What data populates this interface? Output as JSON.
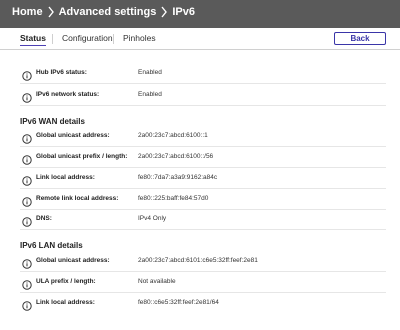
{
  "breadcrumb": {
    "items": [
      "Home",
      "Advanced settings",
      "IPv6"
    ]
  },
  "tabs": [
    {
      "label": "Status",
      "active": true
    },
    {
      "label": "Configuration",
      "active": false
    },
    {
      "label": "Pinholes",
      "active": false
    }
  ],
  "back_button": "Back",
  "status": {
    "hub_ipv6_label": "Hub IPv6 status:",
    "hub_ipv6_value": "Enabled",
    "net_ipv6_label": "IPv6 network status:",
    "net_ipv6_value": "Enabled"
  },
  "wan": {
    "title": "IPv6 WAN details",
    "rows": [
      {
        "label": "Global unicast address:",
        "value": "2a00:23c7:abcd:6100::1"
      },
      {
        "label": "Global unicast prefix / length:",
        "value": "2a00:23c7:abcd:6100::/56"
      },
      {
        "label": "Link local address:",
        "value": "fe80::7da7:a3a9:9162:a84c"
      },
      {
        "label": "Remote link local address:",
        "value": "fe80::225:baff:fe84:57d0"
      },
      {
        "label": "DNS:",
        "value": "IPv4 Only"
      }
    ]
  },
  "lan": {
    "title": "IPv6 LAN details",
    "rows": [
      {
        "label": "Global unicast address:",
        "value": "2a00:23c7:abcd:6101:c6e5:32ff:feef:2e81"
      },
      {
        "label": "ULA prefix / length:",
        "value": "Not available"
      },
      {
        "label": "Link local address:",
        "value": "fe80::c6e5:32ff:feef:2e81/64"
      }
    ]
  },
  "colors": {
    "header_bg": "#5a5a5a",
    "accent": "#3a35a8",
    "text": "#222222"
  }
}
